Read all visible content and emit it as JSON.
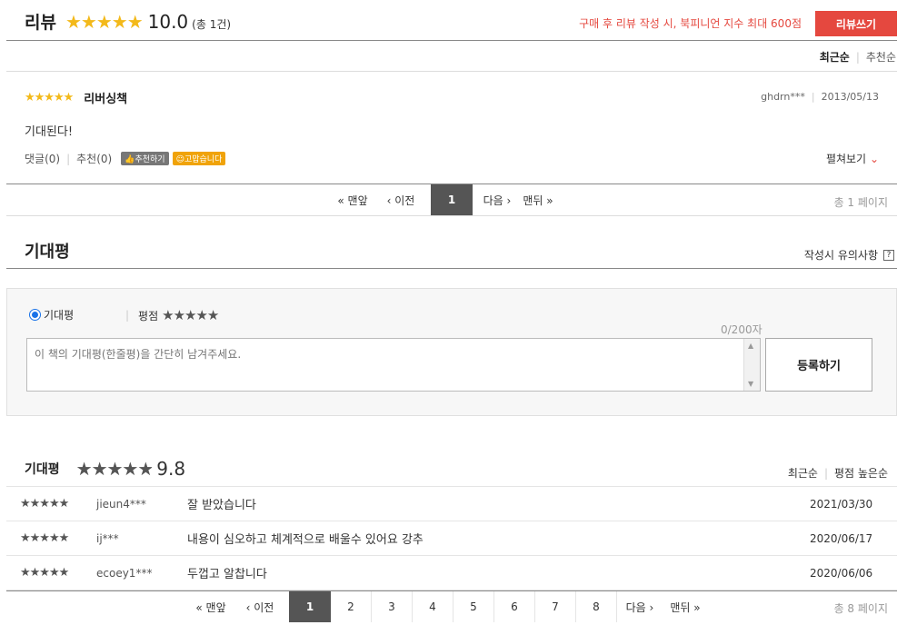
{
  "review": {
    "title": "리뷰",
    "stars": "★★★★★",
    "score": "10.0",
    "count": "(총 1건)",
    "promo": "구매 후 리뷰 작성 시, 북피니언 지수 최대 600점",
    "write_button": "리뷰쓰기",
    "sort": [
      "최근순",
      "추천순"
    ],
    "item": {
      "stars": "★★★★★",
      "title": "리버싱책",
      "user": "ghdrn***",
      "date": "2013/05/13",
      "body": "기대된다!",
      "comments": "댓글(0)",
      "recommends": "추천(0)",
      "recommend_badge": "추천하기",
      "thanks_badge": "고맙습니다",
      "expand": "펼쳐보기"
    },
    "pager": {
      "first": "« 맨앞",
      "prev": "‹ 이전",
      "current": "1",
      "next": "다음 ›",
      "last": "맨뒤 »",
      "total": "총 1 페이지"
    }
  },
  "expect": {
    "title": "기대평",
    "notice": "작성시 유의사항",
    "notice_icon": "?",
    "form": {
      "radio_label": "기대평",
      "rating_label": "평점",
      "rating_stars": "★★★★★",
      "char_count": "0/200자",
      "placeholder": "이 책의 기대평(한줄평)을 간단히 남겨주세요.",
      "submit": "등록하기"
    },
    "summary": {
      "title": "기대평",
      "stars": "★★★★★",
      "score": "9.8",
      "score_value": 9.8,
      "sort": [
        "최근순",
        "평점 높은순"
      ]
    },
    "rows": [
      {
        "stars": "★★★★★",
        "user": "jieun4***",
        "text": "잘 받았습니다",
        "date": "2021/03/30"
      },
      {
        "stars": "★★★★★",
        "user": "ij***",
        "text": "내용이 심오하고 체계적으로 배울수 있어요 강추",
        "date": "2020/06/17"
      },
      {
        "stars": "★★★★★",
        "user": "ecoey1***",
        "text": "두껍고 알찹니다",
        "date": "2020/06/06"
      }
    ],
    "pager": {
      "first": "« 맨앞",
      "prev": "‹ 이전",
      "pages": [
        "1",
        "2",
        "3",
        "4",
        "5",
        "6",
        "7",
        "8"
      ],
      "next": "다음 ›",
      "last": "맨뒤 »",
      "total": "총 8 페이지"
    }
  },
  "colors": {
    "star": "#f3b91a",
    "accent": "#e5483f",
    "promo": "#e5483f",
    "pager_current": "#555555"
  }
}
